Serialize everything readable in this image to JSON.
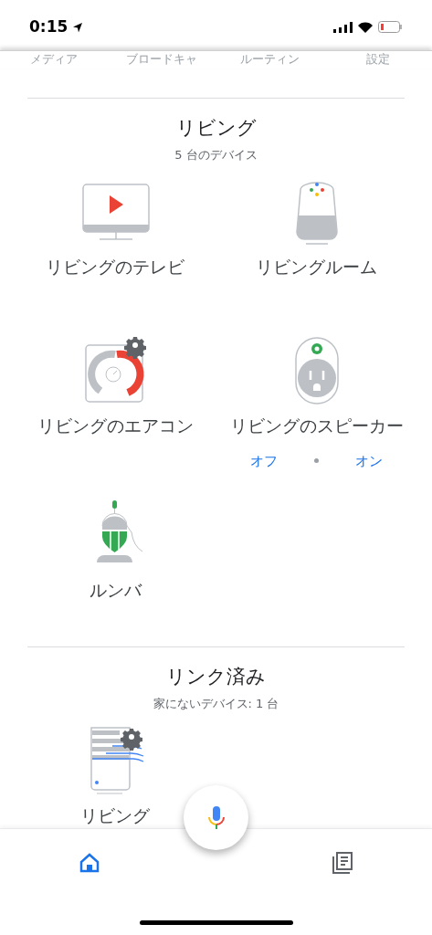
{
  "status_bar": {
    "time": "0:15"
  },
  "top_tabs": [
    "メディア",
    "ブロードキャ",
    "ルーティン",
    "設定"
  ],
  "sections": [
    {
      "title": "リビング",
      "subtitle": "5 台のデバイス",
      "devices": [
        {
          "kind": "tv",
          "name": "リビングのテレビ"
        },
        {
          "kind": "speaker",
          "name": "リビングルーム"
        },
        {
          "kind": "thermostat",
          "name": "リビングのエアコン"
        },
        {
          "kind": "plug",
          "name": "リビングのスピーカー",
          "controls": [
            "オフ",
            "オン"
          ]
        },
        {
          "kind": "vacuum",
          "name": "ルンバ"
        }
      ]
    },
    {
      "title": "リンク済み",
      "subtitle": "家にないデバイス: 1 台",
      "devices": [
        {
          "kind": "purifier",
          "name": "リビング"
        }
      ]
    }
  ],
  "bottom_nav": [
    {
      "kind": "home",
      "selected": true
    },
    {
      "kind": "feed",
      "selected": false
    }
  ]
}
